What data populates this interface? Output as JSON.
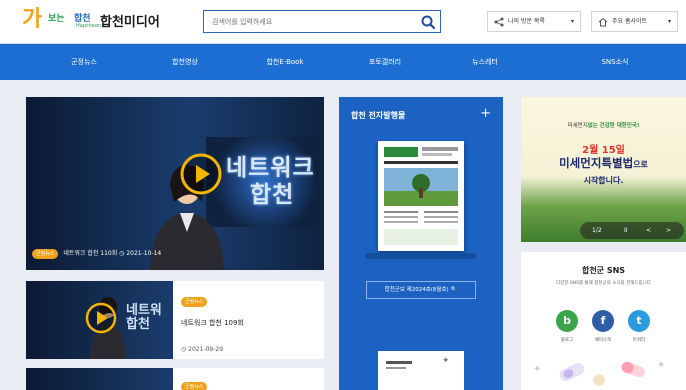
{
  "header": {
    "logo_mark": "가",
    "logo_sub": "보는",
    "logo_sub2": "합천",
    "logo_tiny": "Hapcheon",
    "site_name": "합천미디어",
    "search_placeholder": "검색어를 입력하세요",
    "buttons": [
      {
        "label": "나의 방문 목록"
      },
      {
        "label": "주요 홈사이트"
      }
    ]
  },
  "nav": {
    "items": [
      "군정뉴스",
      "합천영상",
      "합천E-Book",
      "포토갤러리",
      "뉴스레터",
      "SNS소식"
    ]
  },
  "featured_video": {
    "badge": "군정뉴스",
    "title": "네트워크 합천 110회",
    "date": "2021-10-14",
    "overlay_text_line1": "네트워크",
    "overlay_text_line2": "합천"
  },
  "video_list": [
    {
      "badge": "군정뉴스",
      "title": "네트워크 합천 109회",
      "date": "2021-09-29",
      "overlay_line1": "네트워",
      "overlay_line2": "합천"
    },
    {
      "badge": "군정뉴스"
    }
  ],
  "ebook": {
    "title": "합천 전자발행물",
    "more": "+",
    "selector_label": "합천군보 제2024호(8월호)"
  },
  "banner": {
    "line1_a": "미세먼지",
    "line1_b": "없는",
    "line1_c": "건강한 대한민국!",
    "date": "2월 15일",
    "headline": "미세먼지특별법",
    "headline_suffix": "으로",
    "line4": "시작합니다.",
    "pager": "1/2",
    "pause": "II",
    "prev": "<",
    "next": ">"
  },
  "sns": {
    "title": "합천군 SNS",
    "desc": "다양한 SNS를 통해 합천군의 소식을 전해드립니다",
    "channels": [
      {
        "label": "블로그",
        "glyph": "b",
        "color": "#3aa54a"
      },
      {
        "label": "페이스북",
        "glyph": "f",
        "color": "#2f5ea8"
      },
      {
        "label": "트위터",
        "glyph": "t",
        "color": "#2b9be0"
      }
    ]
  },
  "colors": {
    "nav_bg": "#1d6ed2",
    "ebook_bg": "#1b62c2",
    "badge": "#f0a11a",
    "search_border": "#2a66c0"
  }
}
